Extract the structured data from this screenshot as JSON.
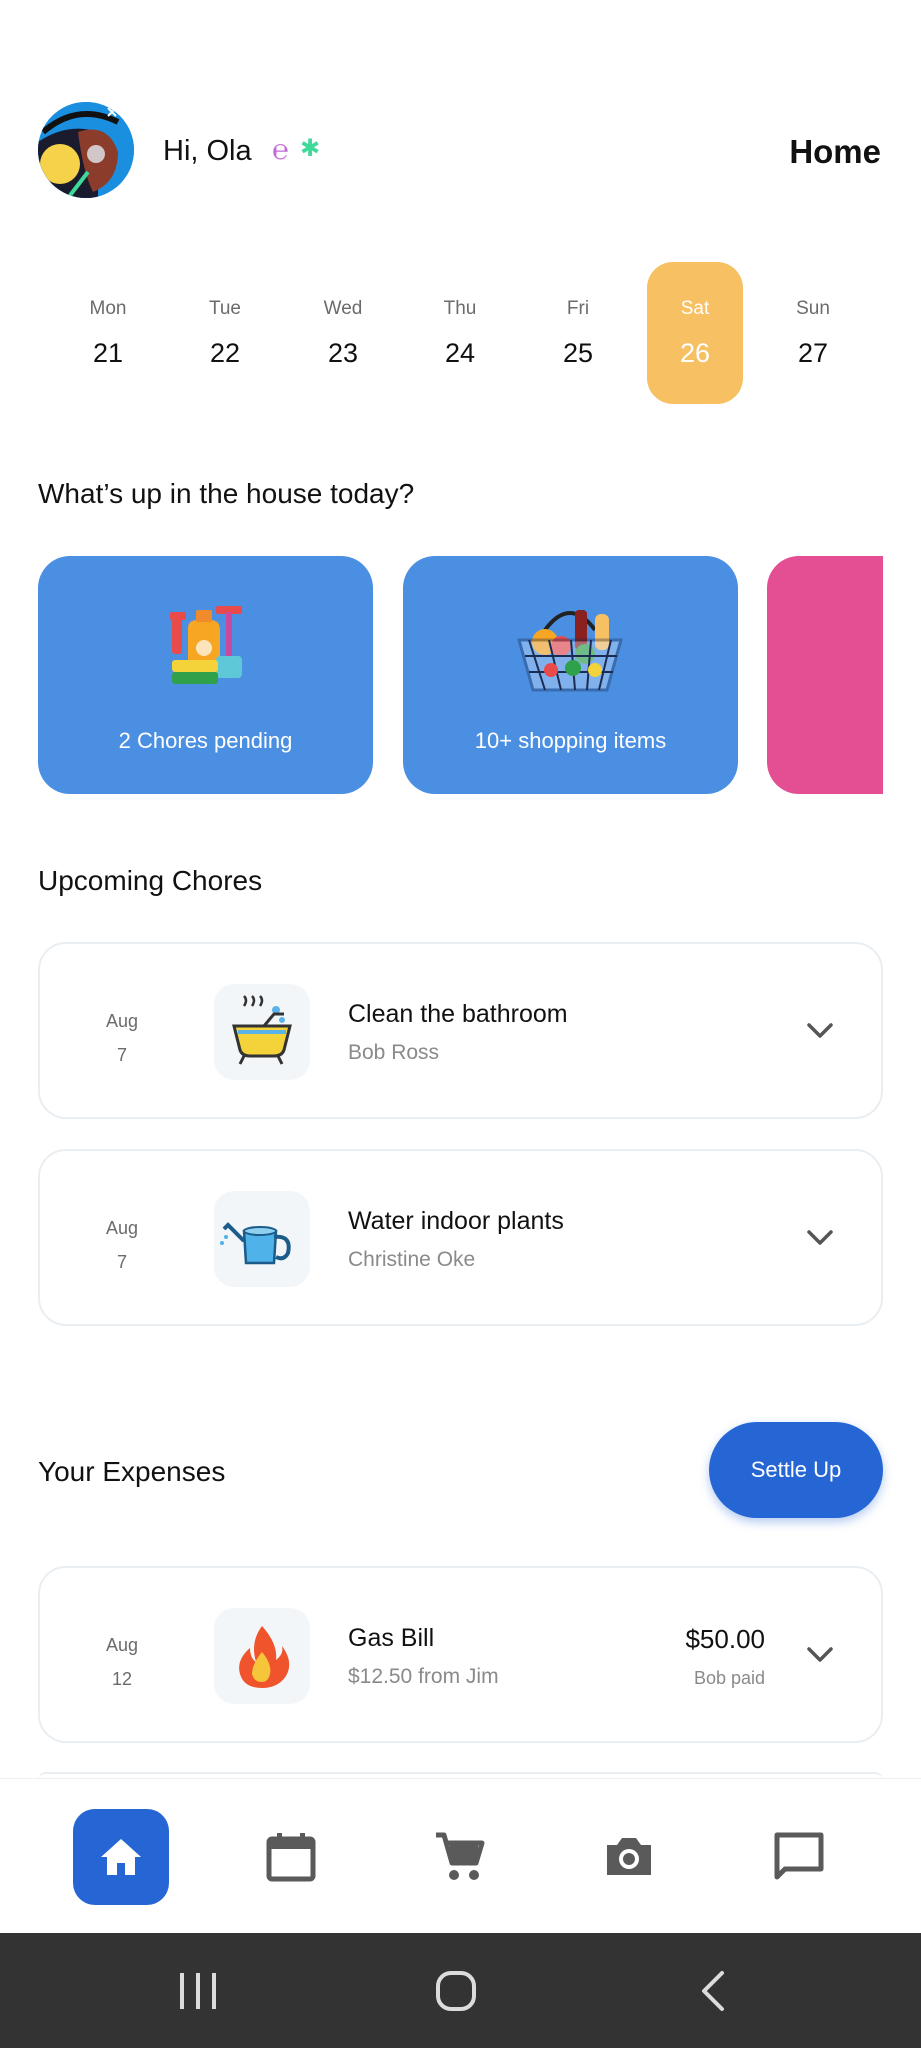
{
  "header": {
    "greeting": "Hi, Ola",
    "squiggle": "℮",
    "sparkle": "✱",
    "page_title": "Home"
  },
  "week": {
    "days": [
      {
        "name": "Mon",
        "date": "21"
      },
      {
        "name": "Tue",
        "date": "22"
      },
      {
        "name": "Wed",
        "date": "23"
      },
      {
        "name": "Thu",
        "date": "24"
      },
      {
        "name": "Fri",
        "date": "25"
      },
      {
        "name": "Sat",
        "date": "26"
      },
      {
        "name": "Sun",
        "date": "27"
      }
    ],
    "selected": "Sat",
    "selected_color": "#f6c063"
  },
  "summary": {
    "title": "What’s up in the house today?",
    "cards": [
      {
        "label": "2 Chores pending",
        "icon": "cleaning-supplies-icon",
        "color": "#4a8fe2"
      },
      {
        "label": "10+ shopping items",
        "icon": "shopping-basket-icon",
        "color": "#4a8fe2"
      },
      {
        "label": "",
        "color": "#e44f93"
      }
    ]
  },
  "chores": {
    "title": "Upcoming Chores",
    "items": [
      {
        "month": "Aug",
        "day": "7",
        "title": "Clean the bathroom",
        "assignee": "Bob Ross",
        "icon": "bathtub-icon"
      },
      {
        "month": "Aug",
        "day": "7",
        "title": "Water indoor plants",
        "assignee": "Christine Oke",
        "icon": "watering-can-icon"
      }
    ]
  },
  "expenses": {
    "title": "Your Expenses",
    "settle_label": "Settle Up",
    "items": [
      {
        "month": "Aug",
        "day": "12",
        "title": "Gas Bill",
        "detail": "$12.50 from Jim",
        "amount": "$50.00",
        "payer": "Bob paid",
        "icon": "fire-icon"
      }
    ]
  },
  "nav": {
    "items": [
      "home-icon",
      "calendar-icon",
      "cart-icon",
      "camera-icon",
      "chat-icon"
    ],
    "active": "home-icon",
    "accent": "#2566d4"
  }
}
